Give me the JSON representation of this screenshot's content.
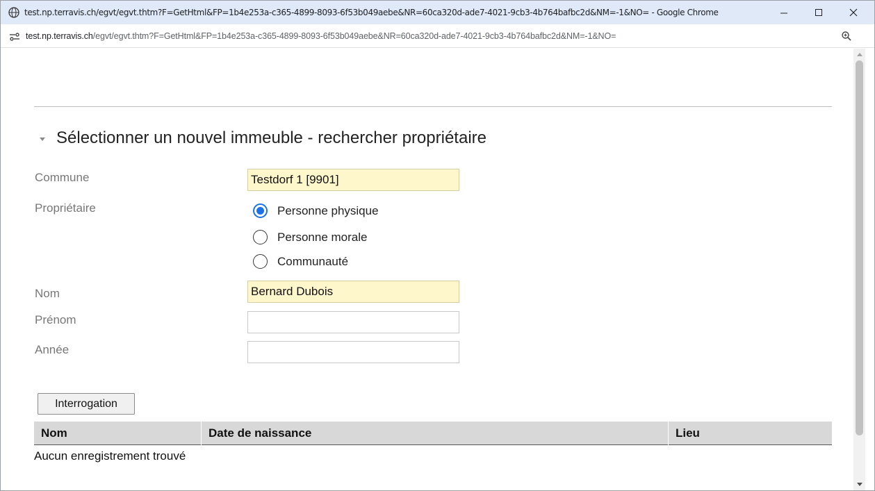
{
  "window": {
    "title": "test.np.terravis.ch/egvt/egvt.thtm?F=GetHtml&FP=1b4e253a-c365-4899-8093-6f53b049aebe&NR=60ca320d-ade7-4021-9cb3-4b764bafbc2d&NM=-1&NO= - Google Chrome",
    "minimize_icon": "minimize-icon",
    "maximize_icon": "maximize-icon",
    "close_icon": "close-icon"
  },
  "address_bar": {
    "host": "test.np.terravis.ch",
    "path": "/egvt/egvt.thtm?F=GetHtml&FP=1b4e253a-c365-4899-8093-6f53b049aebe&NR=60ca320d-ade7-4021-9cb3-4b764bafbc2d&NM=-1&NO=",
    "site_info_icon": "tune-icon",
    "zoom_icon": "zoom-icon"
  },
  "form": {
    "section_title": "Sélectionner un nouvel immeuble - rechercher propriétaire",
    "labels": {
      "commune": "Commune",
      "proprietaire": "Propriétaire",
      "nom": "Nom",
      "prenom": "Prénom",
      "annee": "Année"
    },
    "values": {
      "commune": "Testdorf 1 [9901]",
      "nom": "Bernard Dubois",
      "prenom": "",
      "annee": ""
    },
    "owner_options": [
      {
        "label": "Personne physique",
        "selected": true
      },
      {
        "label": "Personne morale",
        "selected": false
      },
      {
        "label": "Communauté",
        "selected": false
      }
    ],
    "submit_label": "Interrogation"
  },
  "results": {
    "columns": [
      "Nom",
      "Date de naissance",
      "Lieu"
    ],
    "empty_message": "Aucun enregistrement trouvé"
  },
  "colors": {
    "titlebar": "#dfe9f8",
    "filled_field": "#fff7cc",
    "radio_accent": "#1a73e8",
    "table_header": "#d8d8d8"
  }
}
